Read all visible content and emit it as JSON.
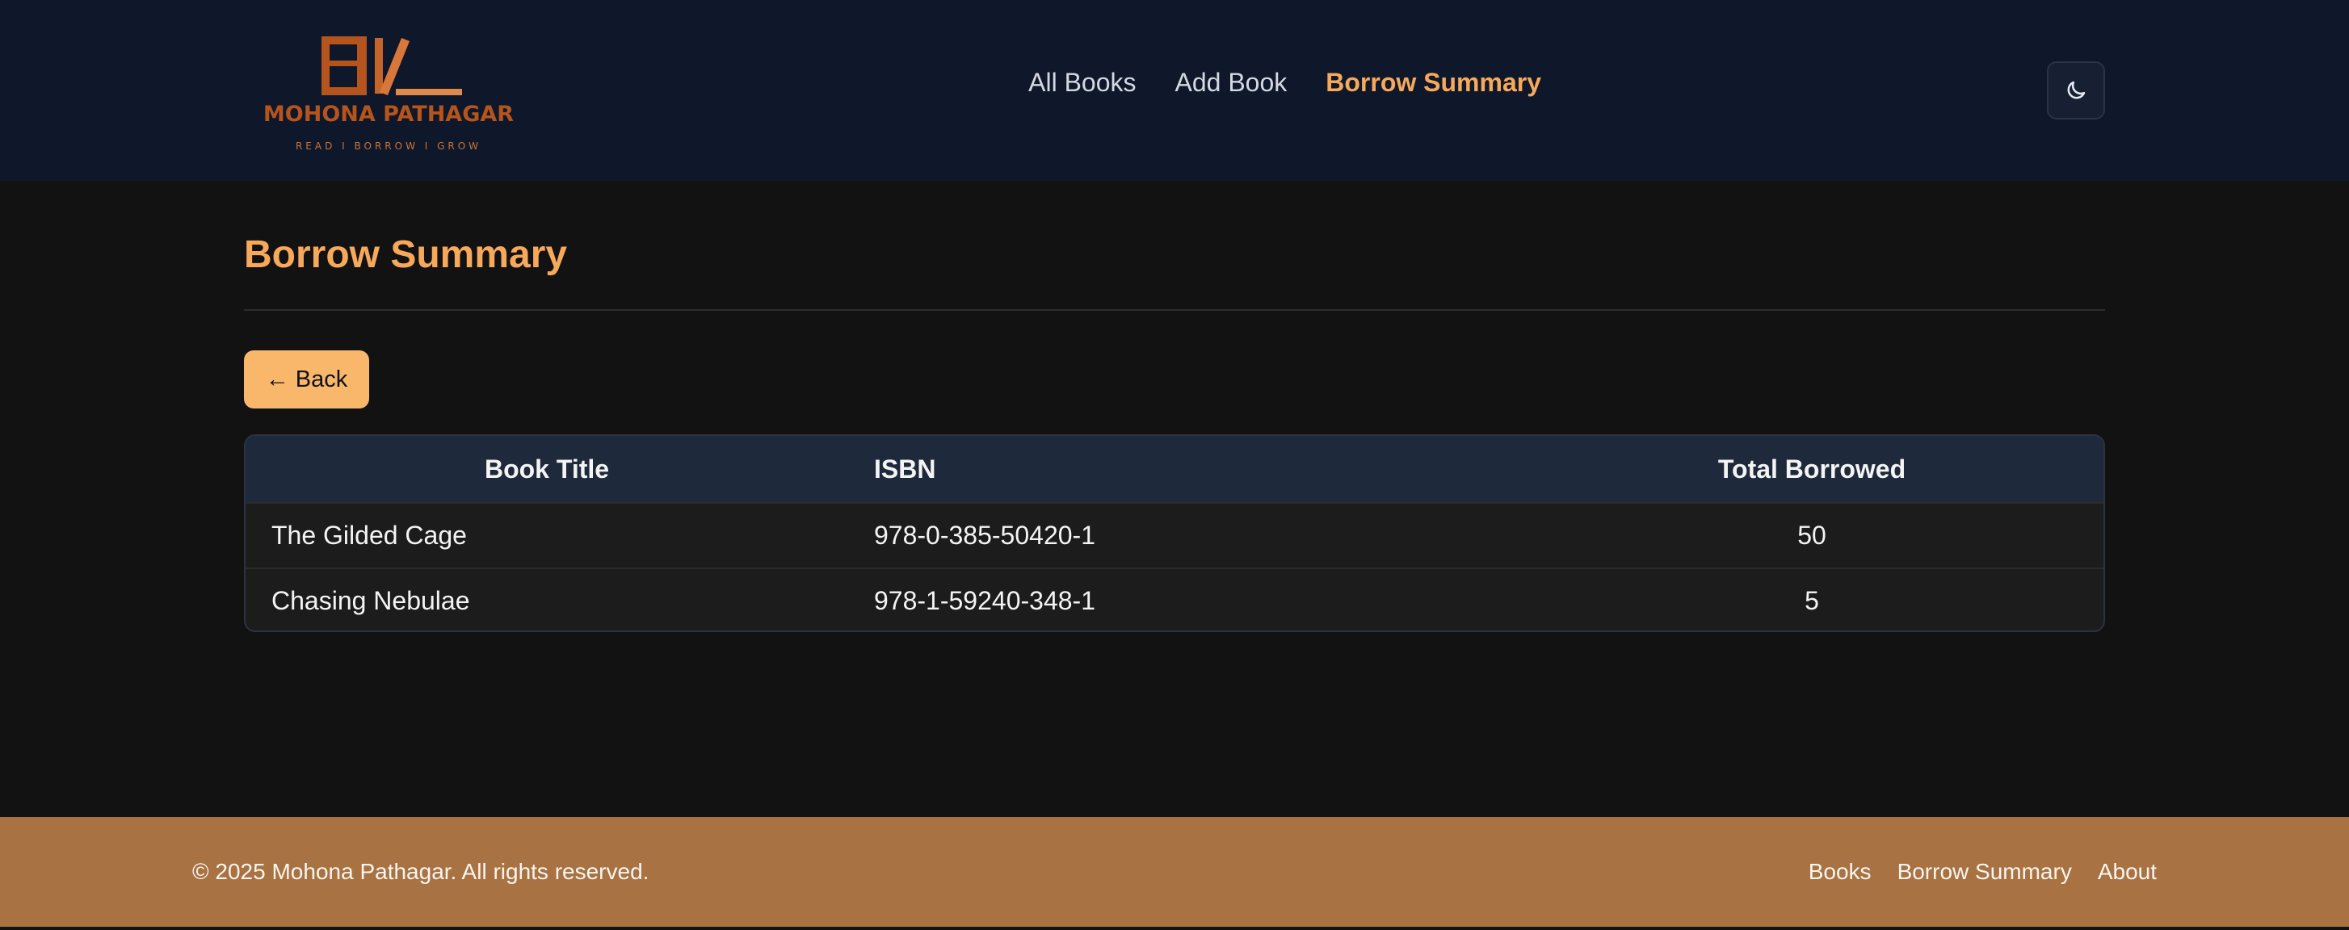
{
  "colors": {
    "header_bg": "#0f172a",
    "page_bg": "#121212",
    "accent": "#f6a95b",
    "button_bg": "#f9b76c",
    "table_header_bg": "#1e293b",
    "footer_bg": "#a87243"
  },
  "brand": {
    "name": "MOHONA PATHAGAR",
    "tagline": "READ I BORROW I GROW"
  },
  "nav": {
    "items": [
      {
        "label": "All Books",
        "active": false
      },
      {
        "label": "Add Book",
        "active": false
      },
      {
        "label": "Borrow Summary",
        "active": true
      }
    ],
    "theme_toggle_icon": "moon-icon"
  },
  "main": {
    "title": "Borrow Summary",
    "back_label": "← Back",
    "table": {
      "headers": [
        "Book Title",
        "ISBN",
        "Total Borrowed"
      ],
      "rows": [
        [
          "The Gilded Cage",
          "978-0-385-50420-1",
          "50"
        ],
        [
          "Chasing Nebulae",
          "978-1-59240-348-1",
          "5"
        ]
      ]
    }
  },
  "footer": {
    "copyright": "© 2025 Mohona Pathagar. All rights reserved.",
    "links": [
      "Books",
      "Borrow Summary",
      "About"
    ]
  }
}
